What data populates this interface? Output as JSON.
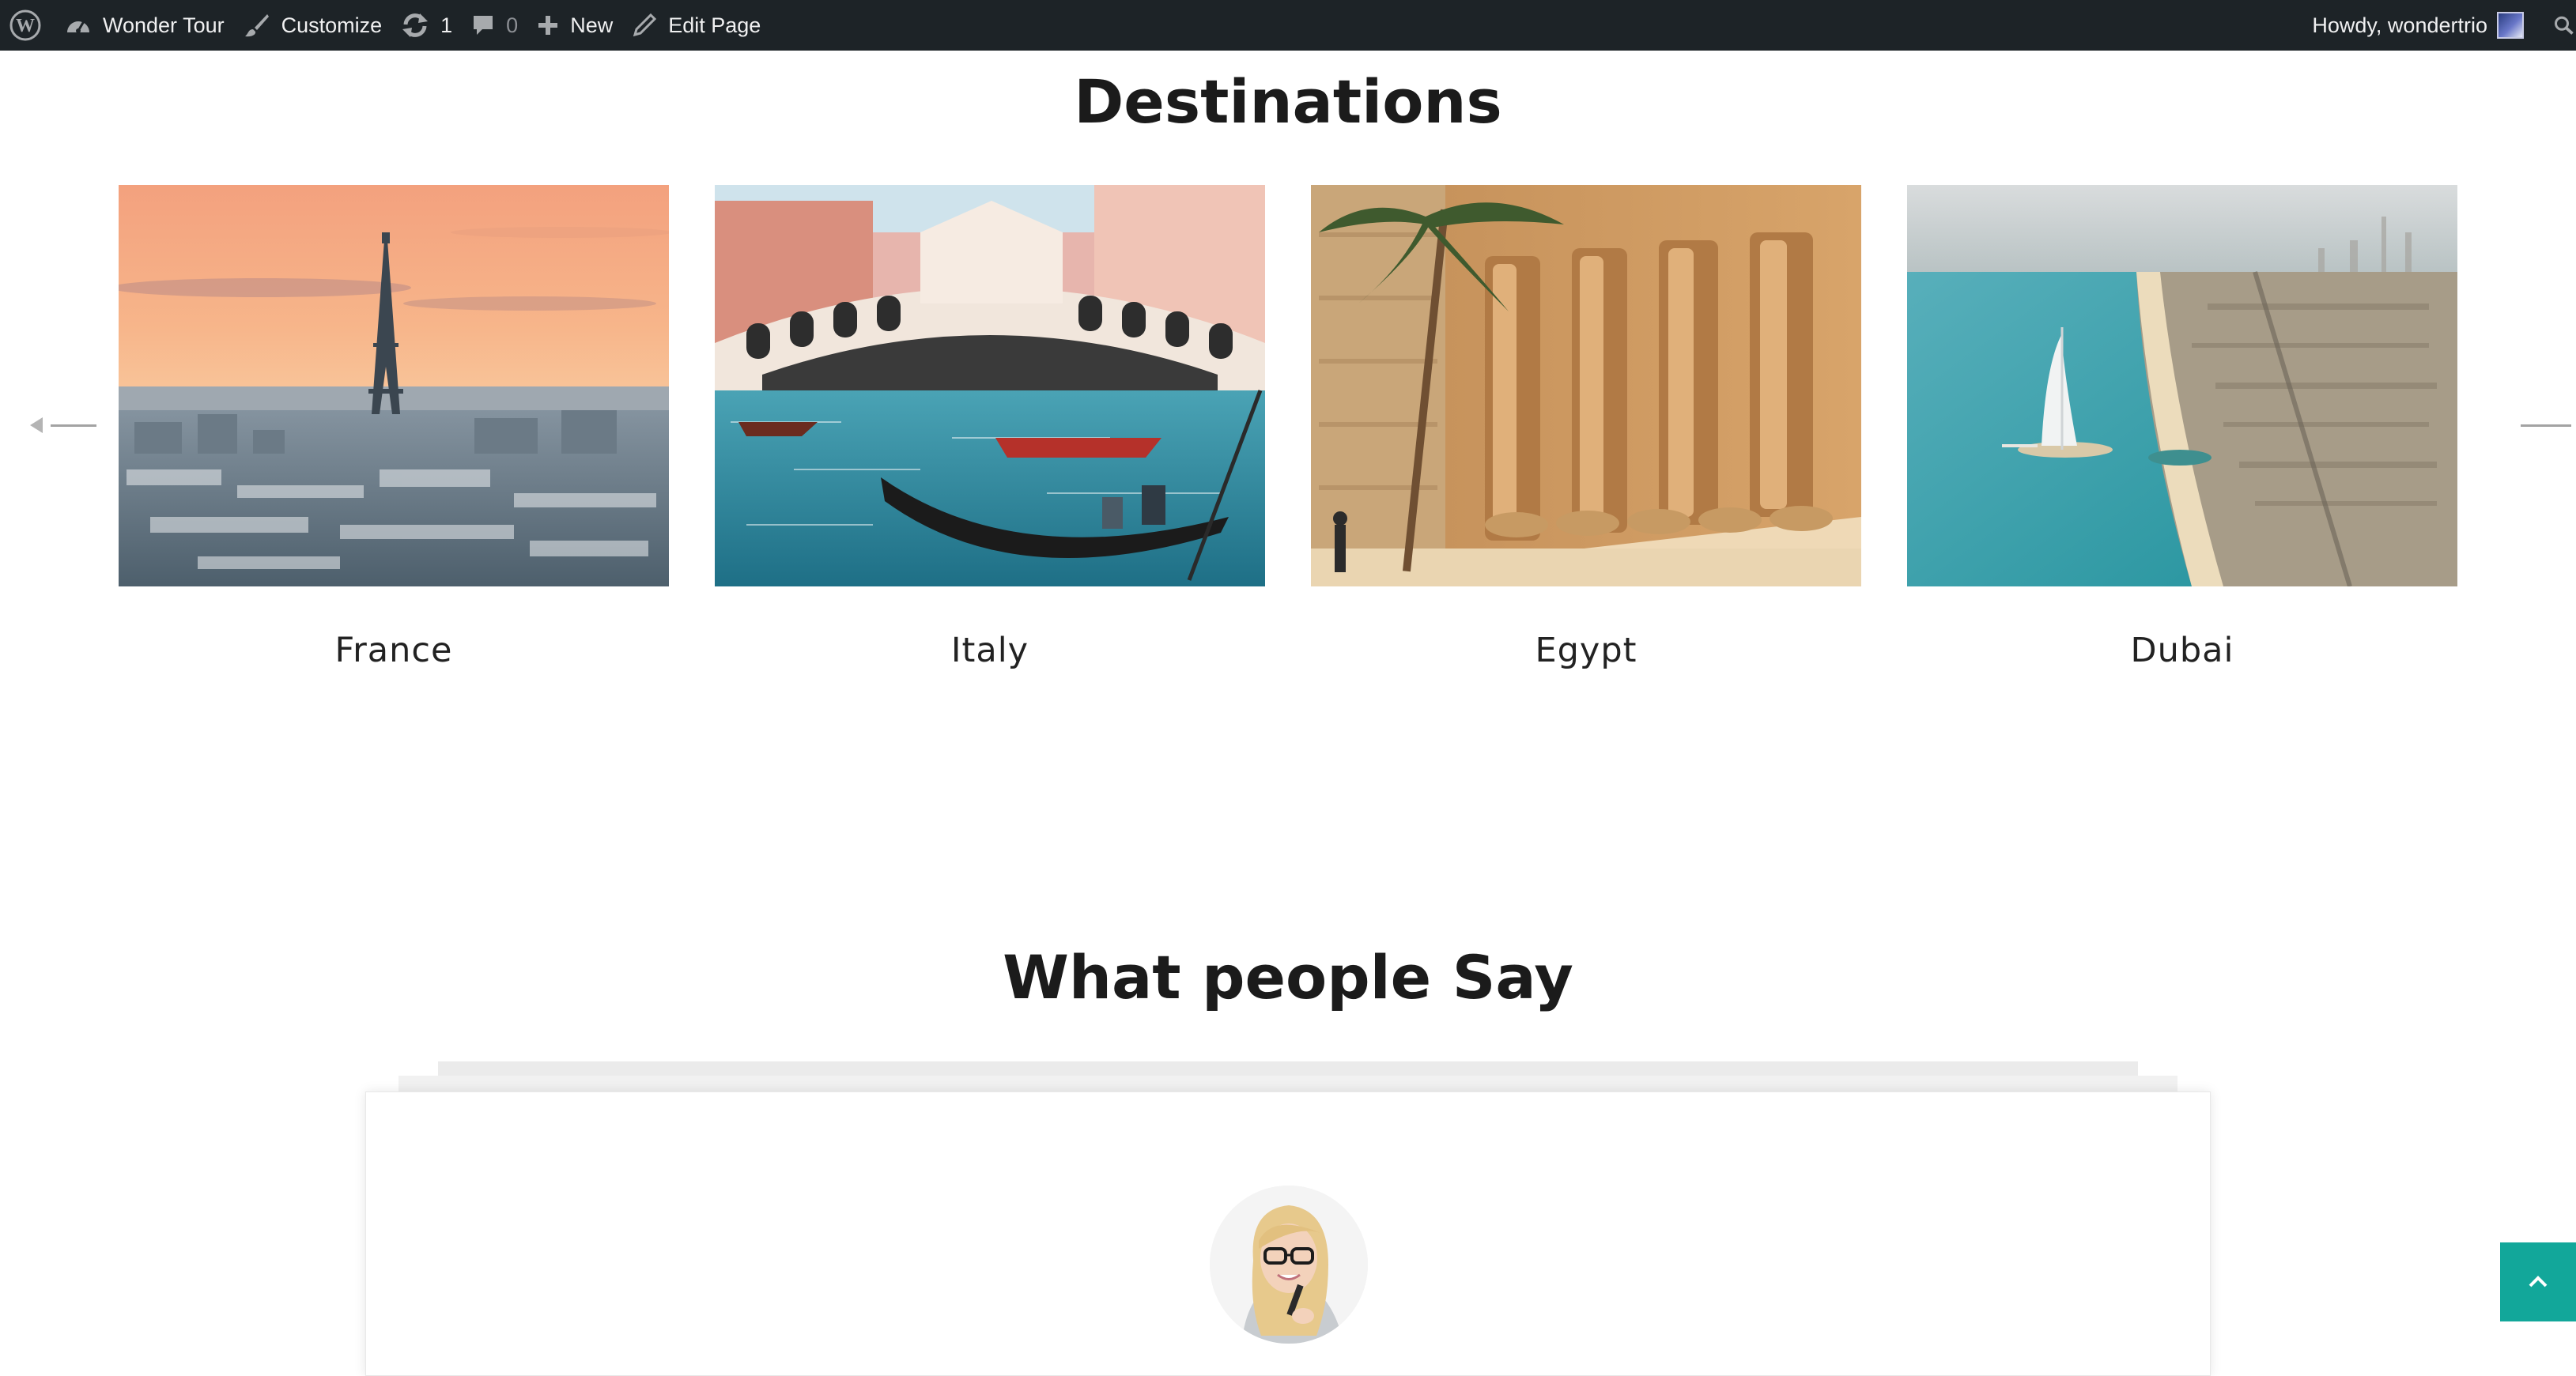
{
  "admin_bar": {
    "site_name": "Wonder Tour",
    "customize": "Customize",
    "updates_count": "1",
    "comments_count": "0",
    "new": "New",
    "edit_page": "Edit Page",
    "greeting": "Howdy, wondertrio"
  },
  "destinations": {
    "title": "Destinations",
    "items": [
      {
        "name": "France",
        "image": "eiffel-tower-paris-sunset"
      },
      {
        "name": "Italy",
        "image": "rialto-bridge-venice"
      },
      {
        "name": "Egypt",
        "image": "karnak-temple-columns"
      },
      {
        "name": "Dubai",
        "image": "burj-al-arab-coastline"
      }
    ]
  },
  "testimonials": {
    "title": "What people Say"
  },
  "colors": {
    "admin_bar_bg": "#1d2327",
    "accent_teal": "#12a79a"
  },
  "icons": [
    "wordpress-logo",
    "dashboard-icon",
    "paintbrush-icon",
    "update-icon",
    "comment-icon",
    "plus-icon",
    "pencil-icon",
    "search-icon",
    "chevron-up-icon"
  ]
}
